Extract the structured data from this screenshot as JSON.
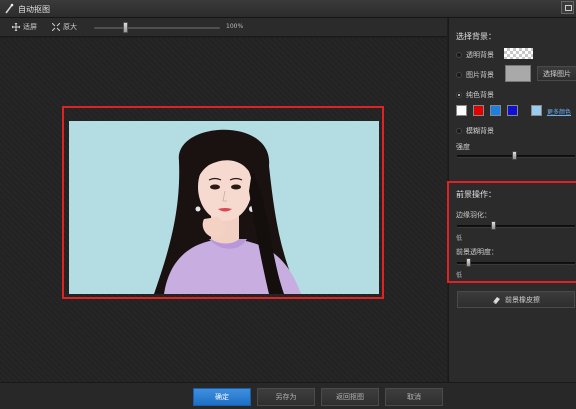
{
  "window": {
    "title": "自动抠图"
  },
  "toolbar": {
    "fit_label": "适屏",
    "enlarge_label": "原大",
    "zoom_value": "100%",
    "zoom_fraction": 0.25
  },
  "panel": {
    "background": {
      "title": "选择背景：",
      "transparent_label": "透明背景",
      "image_label": "图片背景",
      "choose_image_button": "选择图片",
      "solid_label": "纯色背景",
      "more_colors_link": "更多颜色",
      "blur_label": "模糊背景",
      "strength_label": "强度",
      "strength_level": 0.5,
      "colors": [
        "#ffffff",
        "#e00000",
        "#1e7fe0",
        "#1010d0",
        "#99ccee"
      ]
    },
    "foreground": {
      "title": "前景操作：",
      "feather_label": "边缘羽化：",
      "feather_value": "低",
      "feather_level": 0.3,
      "opacity_label": "前景透明度：",
      "opacity_value": "低",
      "opacity_level": 0.12
    },
    "eraser_button": "前景橡皮擦"
  },
  "buttons": {
    "confirm": "确定",
    "save_as": "另存为",
    "back": "返回抠图",
    "cancel": "取消"
  },
  "colors": {
    "highlight": "#e02222",
    "primary": "#2a7fd6",
    "photo_bg": "#b3dde2"
  }
}
